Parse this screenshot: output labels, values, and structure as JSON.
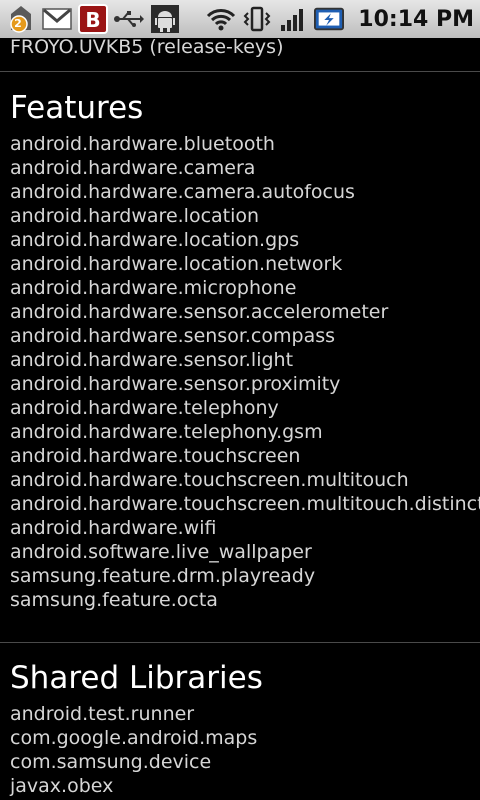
{
  "status_bar": {
    "time": "10:14 PM",
    "notification_count": "2",
    "icons": [
      "notification-count-icon",
      "gmail-icon",
      "b-app-icon",
      "usb-icon",
      "android-debug-icon",
      "wifi-icon",
      "vibrate-icon",
      "signal-icon",
      "battery-charging-icon"
    ]
  },
  "build": {
    "release": "FROYO.UVKB5 (release-keys)"
  },
  "features": {
    "title": "Features",
    "items": [
      "android.hardware.bluetooth",
      "android.hardware.camera",
      "android.hardware.camera.autofocus",
      "android.hardware.location",
      "android.hardware.location.gps",
      "android.hardware.location.network",
      "android.hardware.microphone",
      "android.hardware.sensor.accelerometer",
      "android.hardware.sensor.compass",
      "android.hardware.sensor.light",
      "android.hardware.sensor.proximity",
      "android.hardware.telephony",
      "android.hardware.telephony.gsm",
      "android.hardware.touchscreen",
      "android.hardware.touchscreen.multitouch",
      "android.hardware.touchscreen.multitouch.distinct",
      "android.hardware.wifi",
      "android.software.live_wallpaper",
      "samsung.feature.drm.playready",
      "samsung.feature.octa"
    ]
  },
  "shared_libraries": {
    "title": "Shared Libraries",
    "items": [
      "android.test.runner",
      "com.google.android.maps",
      "com.samsung.device",
      "javax.obex"
    ]
  }
}
